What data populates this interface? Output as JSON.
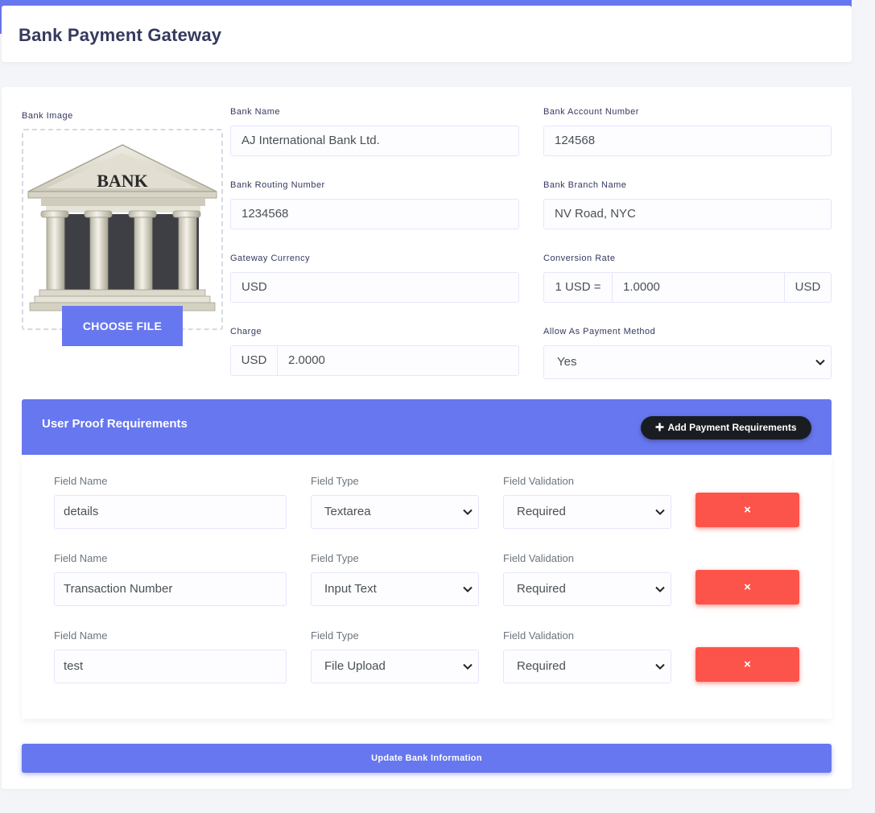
{
  "page": {
    "title": "Bank Payment Gateway"
  },
  "bank_image": {
    "label": "Bank Image",
    "image_text": "BANK",
    "choose_file": "CHOOSE FILE"
  },
  "fields": {
    "bank_name": {
      "label": "Bank Name",
      "value": "AJ International Bank Ltd."
    },
    "account_number": {
      "label": "Bank Account Number",
      "value": "124568"
    },
    "routing_number": {
      "label": "Bank Routing Number",
      "value": "1234568"
    },
    "branch_name": {
      "label": "Bank Branch Name",
      "value": "NV Road, NYC"
    },
    "gateway_currency": {
      "label": "Gateway Currency",
      "value": "USD"
    },
    "conversion_rate": {
      "label": "Conversion Rate",
      "prefix": "1 USD =",
      "value": "1.0000",
      "suffix": "USD"
    },
    "charge": {
      "label": "Charge",
      "prefix": "USD",
      "value": "2.0000"
    },
    "allow_payment": {
      "label": "Allow As Payment Method",
      "value": "Yes"
    }
  },
  "proof": {
    "title": "User Proof Requirements",
    "add_button": "Add Payment Requirements",
    "field_name_label": "Field Name",
    "field_type_label": "Field Type",
    "field_validation_label": "Field Validation",
    "delete_symbol": "×",
    "rows": [
      {
        "name": "details",
        "type": "Textarea",
        "validation": "Required"
      },
      {
        "name": "Transaction Number",
        "type": "Input Text",
        "validation": "Required"
      },
      {
        "name": "test",
        "type": "File Upload",
        "validation": "Required"
      }
    ]
  },
  "update_button": "Update Bank Information",
  "colors": {
    "primary": "#6777ef",
    "danger": "#fc544b",
    "dark": "#191d21"
  },
  "icons": {
    "plus": "plus-icon",
    "close": "close-icon",
    "chevron": "chevron-down-icon"
  }
}
